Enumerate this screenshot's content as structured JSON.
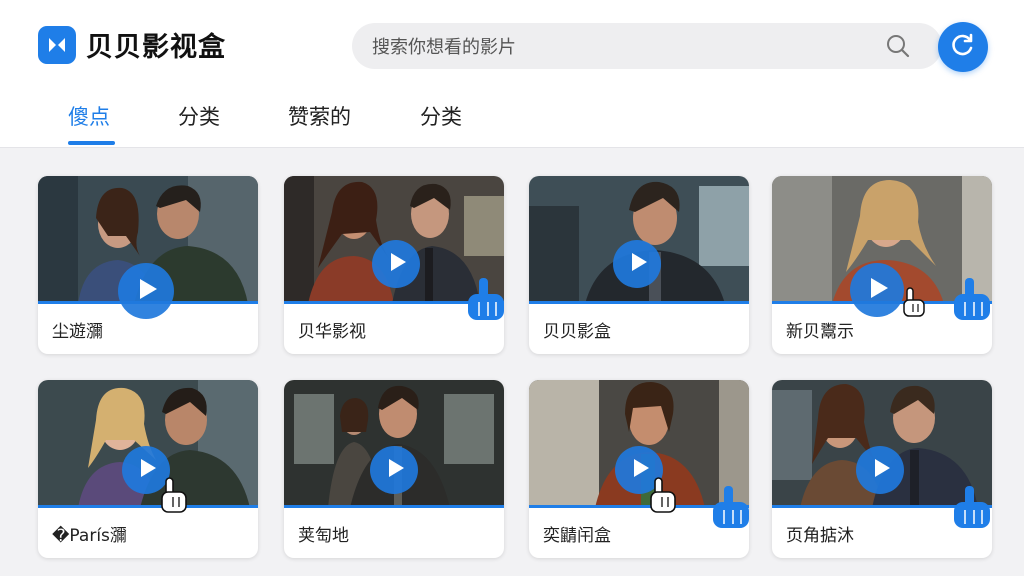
{
  "app": {
    "name": "贝贝影视盒",
    "accent": "#1f7ee8"
  },
  "search": {
    "placeholder": "搜索你想看的影片",
    "icon": "search-icon"
  },
  "header": {
    "refresh_icon": "refresh-icon"
  },
  "tabs": [
    {
      "label": "傻点",
      "active": true
    },
    {
      "label": "分类",
      "active": false
    },
    {
      "label": "赞萦的",
      "active": false
    },
    {
      "label": "分类",
      "active": false
    }
  ],
  "cards": [
    {
      "title": "尘遊瀰"
    },
    {
      "title": "贝华影视"
    },
    {
      "title": "贝贝影盒"
    },
    {
      "title": "新贝鬻示"
    },
    {
      "title": "�París瀰"
    },
    {
      "title": "荚匋地"
    },
    {
      "title": "奕鼱闬盒"
    },
    {
      "title": "页角掂沐"
    }
  ]
}
